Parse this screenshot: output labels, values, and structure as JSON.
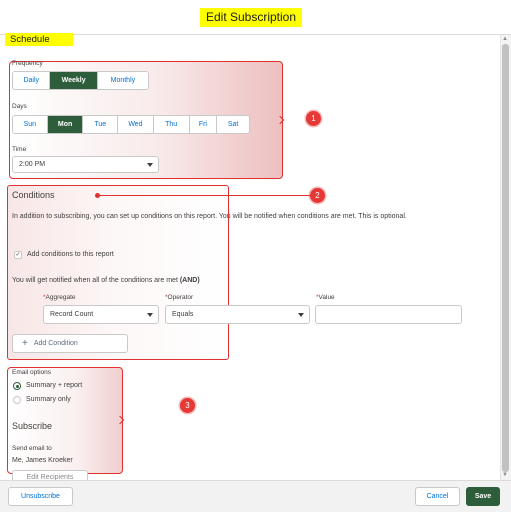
{
  "modal": {
    "title": "Edit Subscription"
  },
  "schedule": {
    "section_title": "Schedule",
    "frequency": {
      "label": "Frequency",
      "options": [
        "Daily",
        "Weekly",
        "Monthly"
      ],
      "selected": "Weekly"
    },
    "days": {
      "label": "Days",
      "options": [
        "Sun",
        "Mon",
        "Tue",
        "Wed",
        "Thu",
        "Fri",
        "Sat"
      ],
      "selected": "Mon"
    },
    "time": {
      "label": "Time",
      "value": "2:00 PM"
    }
  },
  "conditions": {
    "title": "Conditions",
    "description": "In addition to subscribing, you can set up conditions on this report. You will be notified when conditions are met. This is optional.",
    "checkbox_label": "Add conditions to this report",
    "checkbox_checked": true,
    "notify_prefix": "You will get notified when all of the conditions are met ",
    "notify_logic": "(AND)",
    "aggregate": {
      "label": "Aggregate",
      "value": "Record Count"
    },
    "operator": {
      "label": "Operator",
      "value": "Equals"
    },
    "value": {
      "label": "Value",
      "value": ""
    },
    "add_button": "Add Condition"
  },
  "email": {
    "label": "Email options",
    "options": [
      "Summary + report",
      "Summary only"
    ],
    "selected": "Summary + report"
  },
  "subscribe": {
    "title": "Subscribe",
    "send_label": "Send email to",
    "recipient": "Me, James Kroeker",
    "edit_button": "Edit Recipients"
  },
  "callouts": [
    "1",
    "2",
    "3"
  ],
  "footer": {
    "unsubscribe": "Unsubscribe",
    "cancel": "Cancel",
    "save": "Save"
  },
  "colors": {
    "accent": "#2d5d3a",
    "highlight": "#ffff00",
    "callout": "#e03030",
    "link": "#0070d2"
  }
}
